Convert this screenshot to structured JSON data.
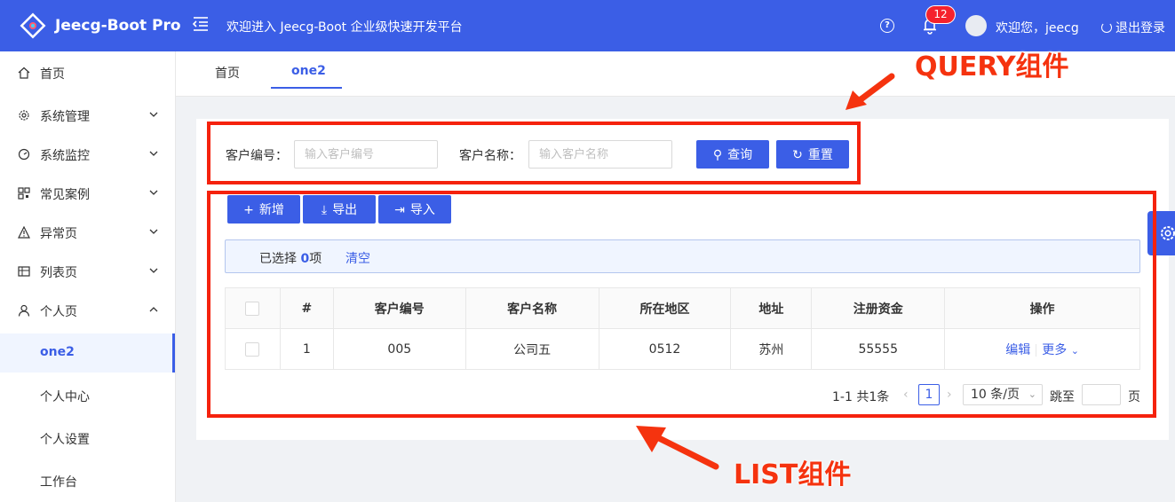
{
  "header": {
    "app_name": "Jeecg-Boot Pro",
    "welcome": "欢迎进入 Jeecg-Boot 企业级快速开发平台",
    "notification_count": "12",
    "user_greeting": "欢迎您，jeecg",
    "logout_label": "退出登录",
    "help_glyph": "?"
  },
  "sidebar": {
    "items": [
      {
        "label": "首页",
        "icon": "home-icon"
      },
      {
        "label": "系统管理",
        "icon": "gear-icon"
      },
      {
        "label": "系统监控",
        "icon": "dashboard-icon"
      },
      {
        "label": "常见案例",
        "icon": "qrcode-icon"
      },
      {
        "label": "异常页",
        "icon": "warning-icon"
      },
      {
        "label": "列表页",
        "icon": "table-icon"
      },
      {
        "label": "个人页",
        "icon": "user-icon"
      }
    ],
    "sub_items": [
      {
        "label": "one2"
      },
      {
        "label": "个人中心"
      },
      {
        "label": "个人设置"
      },
      {
        "label": "工作台"
      }
    ]
  },
  "tabs": [
    {
      "label": "首页"
    },
    {
      "label": "one2"
    }
  ],
  "query": {
    "field1_label": "客户编号：",
    "field1_placeholder": "输入客户编号",
    "field2_label": "客户名称：",
    "field2_placeholder": "输入客户名称",
    "search_label": "查询",
    "reset_label": "重置"
  },
  "toolbar": {
    "add_label": "新增",
    "export_label": "导出",
    "import_label": "导入"
  },
  "selection": {
    "prefix": "已选择 ",
    "count": "0",
    "suffix": "项",
    "clear_label": "清空"
  },
  "table": {
    "columns": [
      "#",
      "客户编号",
      "客户名称",
      "所在地区",
      "地址",
      "注册资金",
      "操作"
    ],
    "rows": [
      {
        "index": "1",
        "code": "005",
        "name": "公司五",
        "region": "0512",
        "address": "苏州",
        "capital": "55555"
      }
    ],
    "edit_label": "编辑",
    "more_label": "更多"
  },
  "pagination": {
    "total": "1-1 共1条",
    "current_page": "1",
    "page_size": "10 条/页",
    "jump_label": "跳至",
    "page_label": "页"
  },
  "annotations": {
    "query_label": "QUERY组件",
    "list_label": "LIST组件"
  },
  "colors": {
    "primary": "#3b5ee6",
    "annotation_red": "#f5220d",
    "badge_red": "#f5222d"
  }
}
